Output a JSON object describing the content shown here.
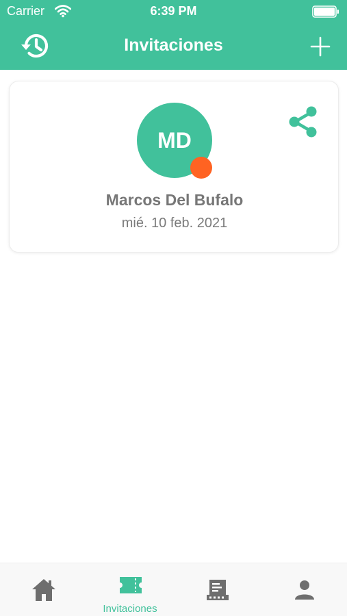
{
  "status_bar": {
    "carrier": "Carrier",
    "time": "6:39 PM",
    "wifi_icon": "wifi-icon",
    "battery_icon": "battery-icon"
  },
  "nav": {
    "title": "Invitaciones",
    "left_icon": "history-icon",
    "right_icon": "plus-icon"
  },
  "invitation": {
    "initials": "MD",
    "name": "Marcos Del Bufalo",
    "date": "mié. 10 feb. 2021",
    "status_color": "#ff6322",
    "share_icon": "share-icon"
  },
  "tabbar": {
    "tabs": [
      {
        "icon": "home-icon",
        "label": "",
        "active": false
      },
      {
        "icon": "ticket-icon",
        "label": "Invitaciones",
        "active": true
      },
      {
        "icon": "register-icon",
        "label": "",
        "active": false
      },
      {
        "icon": "user-icon",
        "label": "",
        "active": false
      }
    ]
  },
  "colors": {
    "accent": "#41c19b",
    "inactive_icon": "#6e6e6e",
    "status_dot": "#ff6322"
  }
}
